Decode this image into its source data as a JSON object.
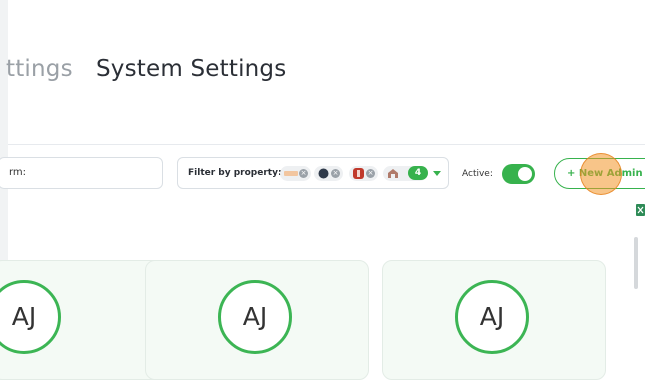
{
  "tabs": [
    {
      "label": "ttings"
    },
    {
      "label": "System Settings"
    }
  ],
  "search": {
    "value": "rm:"
  },
  "filter": {
    "label": "Filter by property:",
    "chips": [
      {
        "logo": "property-logo-small"
      },
      {
        "logo": "property-logo-dark-circle"
      },
      {
        "logo": "property-logo-red-badge"
      },
      {
        "logo": "property-logo-building"
      }
    ],
    "extra_count": "4"
  },
  "active": {
    "label": "Active:",
    "on": true
  },
  "new_admin": {
    "label": "+ New Admin"
  },
  "cards": [
    {
      "initials": "AJ"
    },
    {
      "initials": "AJ"
    },
    {
      "initials": "AJ"
    }
  ],
  "colors": {
    "accent": "#37b24d",
    "card_bg": "#f4faf5"
  }
}
